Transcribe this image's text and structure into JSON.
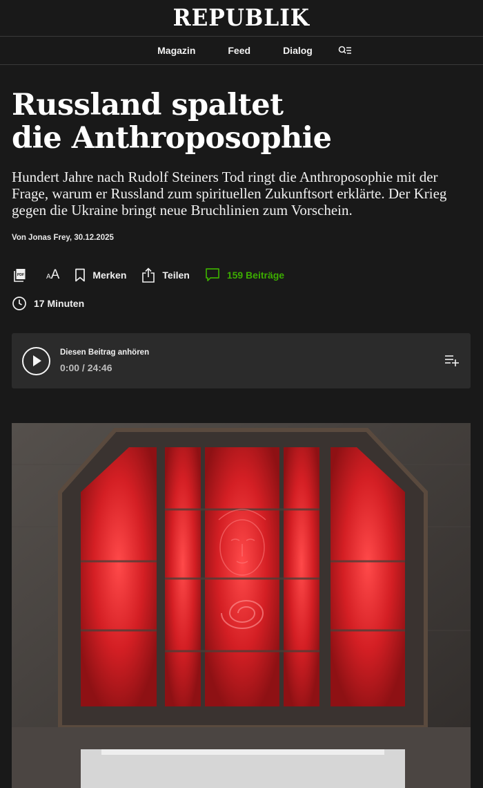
{
  "header": {
    "logo": "REPUBLIK"
  },
  "nav": {
    "items": [
      {
        "label": "Magazin"
      },
      {
        "label": "Feed"
      },
      {
        "label": "Dialog"
      }
    ],
    "search_icon": "search-menu-icon"
  },
  "article": {
    "title_line1": "Russland spaltet",
    "title_line2": "die Anthroposophie",
    "lead": "Hundert Jahre nach Rudolf Steiners Tod ringt die Anthroposophie mit der Frage, warum er Russland zum spirituellen Zukunftsort erklärte. Der Krieg gegen die Ukraine bringt neue Bruchlinien zum Vorschein.",
    "byline": "Von Jonas Frey, 30.12.2025"
  },
  "actions": {
    "pdf_icon_text": "PDF",
    "fontsize_small": "A",
    "fontsize_big": "A",
    "bookmark_label": "Merken",
    "share_label": "Teilen",
    "comments_label": "159 Beiträge",
    "comments_color": "#3cad00"
  },
  "reading_time": {
    "label": "17 Minuten"
  },
  "audio_player": {
    "title": "Diesen Beitrag anhören",
    "time": "0:00 / 24:46"
  },
  "colors": {
    "background": "#191919",
    "player_bg": "#2b2b2b",
    "accent_green": "#3cad00",
    "window_red": "#d92a2a"
  }
}
